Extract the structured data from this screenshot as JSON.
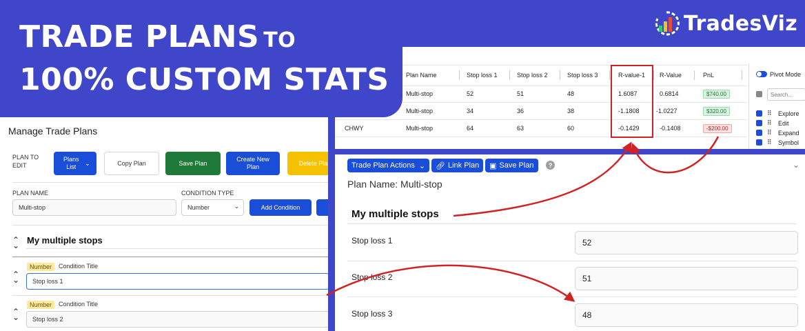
{
  "hero": {
    "line1": "TRADE PLANS",
    "line1_small": "TO",
    "line2": "100% CUSTOM STATS"
  },
  "brand": {
    "name": "TradesViz"
  },
  "manage": {
    "title": "Manage Trade Plans",
    "plan_to_edit_label": "PLAN TO EDIT",
    "plans_list": "Plans List",
    "copy_plan": "Copy Plan",
    "save_plan": "Save Plan",
    "create_new_plan": "Create New Plan",
    "delete_plan": "Delete Plan",
    "plan_name_label": "PLAN NAME",
    "plan_name_value": "Multi-stop",
    "condition_type_label": "CONDITION TYPE",
    "condition_type_value": "Number",
    "add_condition": "Add Condition",
    "section_title": "My multiple stops",
    "conditions": [
      {
        "badge": "Number",
        "title_label": "Condition Title",
        "value": "Stop loss 1"
      },
      {
        "badge": "Number",
        "title_label": "Condition Title",
        "value": "Stop loss 2"
      }
    ]
  },
  "grid": {
    "headers": [
      "Plan Name",
      "Stop loss 1",
      "Stop loss 2",
      "Stop loss 3",
      "R-value-1",
      "R-Value",
      "PnL"
    ],
    "rows": [
      {
        "symbol": "",
        "plan": "Multi-stop",
        "sl1": "52",
        "sl2": "51",
        "sl3": "48",
        "r1": "1.6087",
        "rv": "0.6814",
        "pnl": "$740.00"
      },
      {
        "symbol": "",
        "plan": "Multi-stop",
        "sl1": "34",
        "sl2": "36",
        "sl3": "38",
        "r1": "-1.1808",
        "rv": "-1.0227",
        "pnl": "$320.00"
      },
      {
        "symbol": "CHWY",
        "plan": "Multi-stop",
        "sl1": "64",
        "sl2": "63",
        "sl3": "60",
        "r1": "-0.1429",
        "rv": "-0.1408",
        "pnl": "-$200.00"
      }
    ],
    "side": {
      "pivot_mode": "Pivot Mode",
      "search_placeholder": "Search...",
      "columns": [
        "Explore",
        "Edit",
        "Expand",
        "Symbol"
      ]
    },
    "colors": {
      "pnl_pos": "#1b7a3a",
      "pnl_neg": "#b3261e"
    }
  },
  "plan": {
    "actions_button": "Trade Plan Actions",
    "link_plan": "Link Plan",
    "save_plan": "Save Plan",
    "help": "?",
    "plan_name_line": "Plan Name: Multi-stop",
    "section_title": "My multiple stops",
    "fields": [
      {
        "label": "Stop loss 1",
        "value": "52"
      },
      {
        "label": "Stop loss 2",
        "value": "51"
      },
      {
        "label": "Stop loss 3",
        "value": "48"
      }
    ]
  },
  "colors": {
    "brand_blue": "#3f46c9",
    "button_blue": "#1b4ed8",
    "arrow_red": "#d12323"
  }
}
